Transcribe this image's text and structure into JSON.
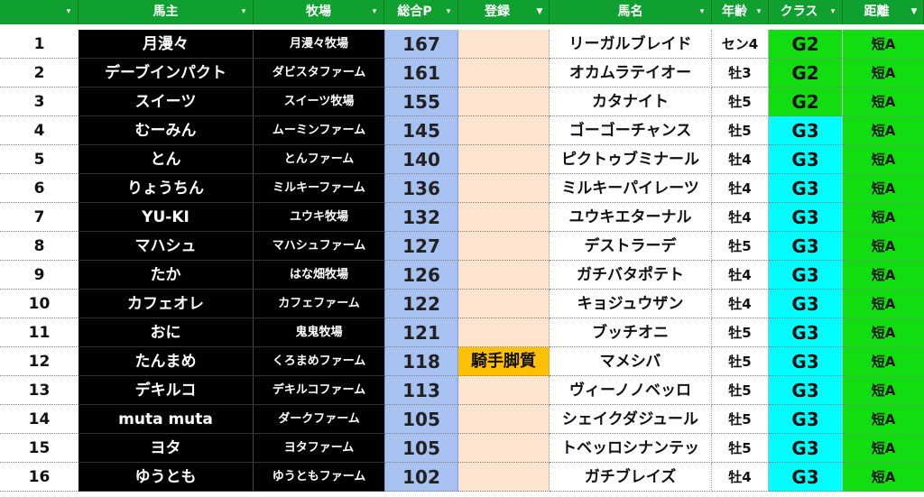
{
  "header": {
    "rank": "",
    "owner": "馬主",
    "farm": "牧場",
    "points": "総合P",
    "register": "登録",
    "horse": "馬名",
    "age": "年齢",
    "class": "クラス",
    "distance": "距離",
    "filter_icon": "▾",
    "filter_active_icon": "▼"
  },
  "rows": [
    {
      "rank": "1",
      "owner": "月漫々",
      "farm": "月漫々牧場",
      "points": "167",
      "register": "",
      "horse": "リーガルブレイド",
      "age": "セン4",
      "class": "G2",
      "distance": "短A"
    },
    {
      "rank": "2",
      "owner": "デーブインパクト",
      "farm": "ダビスタファーム",
      "points": "161",
      "register": "",
      "horse": "オカムラテイオー",
      "age": "牡3",
      "class": "G2",
      "distance": "短A"
    },
    {
      "rank": "3",
      "owner": "スイーツ",
      "farm": "スイーツ牧場",
      "points": "155",
      "register": "",
      "horse": "カタナイト",
      "age": "牡5",
      "class": "G2",
      "distance": "短A"
    },
    {
      "rank": "4",
      "owner": "むーみん",
      "farm": "ムーミンファーム",
      "points": "145",
      "register": "",
      "horse": "ゴーゴーチャンス",
      "age": "牡5",
      "class": "G3",
      "distance": "短A"
    },
    {
      "rank": "5",
      "owner": "とん",
      "farm": "とんファーム",
      "points": "140",
      "register": "",
      "horse": "ピクトゥブミナール",
      "age": "牡4",
      "class": "G3",
      "distance": "短A"
    },
    {
      "rank": "6",
      "owner": "りょうちん",
      "farm": "ミルキーファーム",
      "points": "136",
      "register": "",
      "horse": "ミルキーパイレーツ",
      "age": "牡4",
      "class": "G3",
      "distance": "短A"
    },
    {
      "rank": "7",
      "owner": "YU-KI",
      "farm": "ユウキ牧場",
      "points": "132",
      "register": "",
      "horse": "ユウキエターナル",
      "age": "牡4",
      "class": "G3",
      "distance": "短A"
    },
    {
      "rank": "8",
      "owner": "マハシュ",
      "farm": "マハシュファーム",
      "points": "127",
      "register": "",
      "horse": "デストラーデ",
      "age": "牡5",
      "class": "G3",
      "distance": "短A"
    },
    {
      "rank": "9",
      "owner": "たか",
      "farm": "はな畑牧場",
      "points": "126",
      "register": "",
      "horse": "ガチバタポテト",
      "age": "牡4",
      "class": "G3",
      "distance": "短A"
    },
    {
      "rank": "10",
      "owner": "カフェオレ",
      "farm": "カフェファーム",
      "points": "122",
      "register": "",
      "horse": "キョジュウザン",
      "age": "牡4",
      "class": "G3",
      "distance": "短A"
    },
    {
      "rank": "11",
      "owner": "おに",
      "farm": "鬼鬼牧場",
      "points": "121",
      "register": "",
      "horse": "ブッチオニ",
      "age": "牡5",
      "class": "G3",
      "distance": "短A"
    },
    {
      "rank": "12",
      "owner": "たんまめ",
      "farm": "くろまめファーム",
      "points": "118",
      "register": "騎手脚質",
      "horse": "マメシバ",
      "age": "牡5",
      "class": "G3",
      "distance": "短A"
    },
    {
      "rank": "13",
      "owner": "デキルコ",
      "farm": "デキルコファーム",
      "points": "113",
      "register": "",
      "horse": "ヴィーノノベッロ",
      "age": "牡5",
      "class": "G3",
      "distance": "短A"
    },
    {
      "rank": "14",
      "owner": "muta muta",
      "farm": "ダークファーム",
      "points": "105",
      "register": "",
      "horse": "シェイクダジュール",
      "age": "牡5",
      "class": "G3",
      "distance": "短A"
    },
    {
      "rank": "15",
      "owner": "ヨタ",
      "farm": "ヨタファーム",
      "points": "105",
      "register": "",
      "horse": "トベッロシナンテッ",
      "age": "牡5",
      "class": "G3",
      "distance": "短A"
    },
    {
      "rank": "16",
      "owner": "ゆうとも",
      "farm": "ゆうともファーム",
      "points": "102",
      "register": "",
      "horse": "ガチブレイズ",
      "age": "牡4",
      "class": "G3",
      "distance": "短A"
    }
  ],
  "colors": {
    "header_bg": "#10a030",
    "owner_bg": "#000000",
    "points_bg": "#a7c1f0",
    "register_bg": "#fce4cf",
    "register_highlight": "#ffc000",
    "class_g2": "#11dd11",
    "class_g3": "#00ffff",
    "distance_bg": "#11dd11"
  }
}
